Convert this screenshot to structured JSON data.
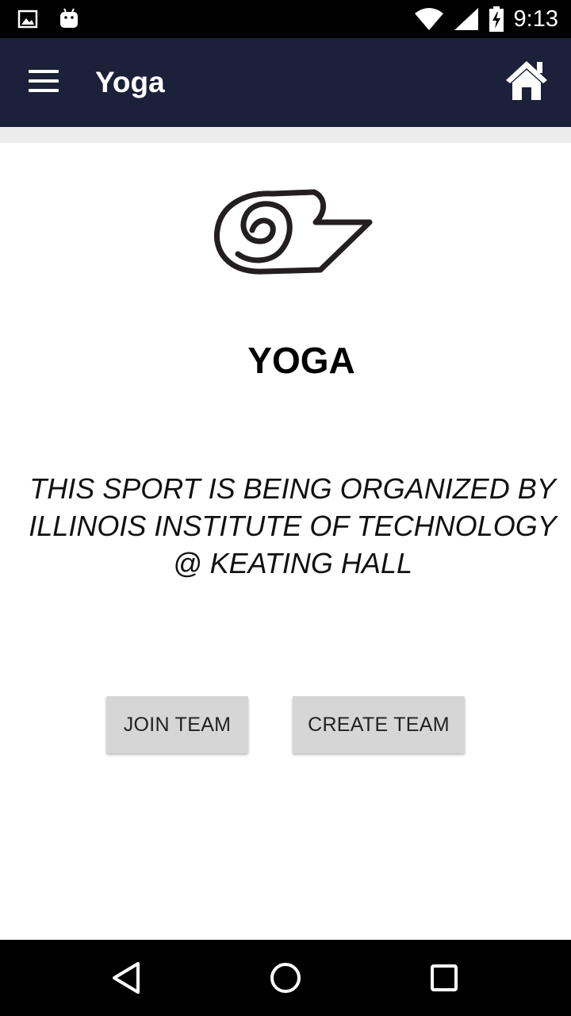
{
  "status_bar": {
    "time": "9:13",
    "icons": [
      "image-notification-icon",
      "android-notification-icon",
      "wifi-icon",
      "cell-signal-icon",
      "battery-charging-icon"
    ]
  },
  "app_bar": {
    "title": "Yoga",
    "menu_icon": "hamburger-menu-icon",
    "home_icon": "home-icon",
    "background_color": "#1c213a"
  },
  "main": {
    "sport_icon": "yoga-mat-icon",
    "sport_name": "YOGA",
    "organizer_text": "THIS SPORT IS BEING ORGANIZED BY ILLINOIS INSTITUTE OF TECHNOLOGY @ KEATING HALL",
    "join_button_label": "JOIN TEAM",
    "create_button_label": "CREATE TEAM"
  },
  "nav_bar": {
    "icons": [
      "back-icon",
      "home-circle-icon",
      "recents-icon"
    ]
  }
}
